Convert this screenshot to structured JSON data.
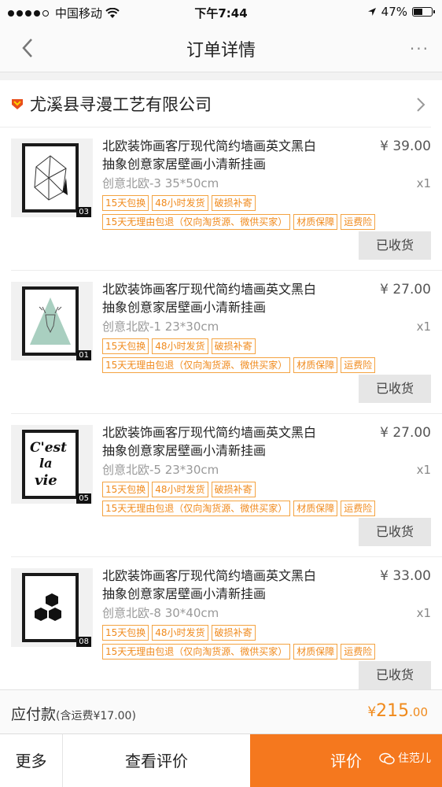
{
  "status": {
    "carrier": "中国移动",
    "time": "下午7:44",
    "battery": "47%"
  },
  "nav": {
    "title": "订单详情",
    "more": "···"
  },
  "shop": {
    "name": "尤溪县寻漫工艺有限公司"
  },
  "tags_row1": [
    "15天包换",
    "48小时发货",
    "破损补寄"
  ],
  "tags_row2": [
    "15天无理由包退（仅向淘货源、微供买家）",
    "材质保障",
    "运费险"
  ],
  "items": [
    {
      "title_line1": "北欧装饰画客厅现代简约墙画英文黑白",
      "title_line2": "抽象创意家居壁画小清新挂画",
      "sku": "创意北欧-3 35*50cm",
      "price": "¥ 39.00",
      "qty": "x1",
      "thumb_num": "03",
      "button": "已收货"
    },
    {
      "title_line1": "北欧装饰画客厅现代简约墙画英文黑白",
      "title_line2": "抽象创意家居壁画小清新挂画",
      "sku": "创意北欧-1 23*30cm",
      "price": "¥ 27.00",
      "qty": "x1",
      "thumb_num": "01",
      "button": "已收货"
    },
    {
      "title_line1": "北欧装饰画客厅现代简约墙画英文黑白",
      "title_line2": "抽象创意家居壁画小清新挂画",
      "sku": "创意北欧-5 23*30cm",
      "price": "¥ 27.00",
      "qty": "x1",
      "thumb_num": "05",
      "button": "已收货",
      "art_text": [
        "C'est",
        "la",
        "vie"
      ]
    },
    {
      "title_line1": "北欧装饰画客厅现代简约墙画英文黑白",
      "title_line2": "抽象创意家居壁画小清新挂画",
      "sku": "创意北欧-8 30*40cm",
      "price": "¥ 33.00",
      "qty": "x1",
      "thumb_num": "08",
      "button": "已收货"
    }
  ],
  "total": {
    "label": "应付款",
    "shipping": "(含运费¥17.00)",
    "currency": "¥",
    "amount_int": "215",
    "amount_dec": ".00"
  },
  "bottom": {
    "more": "更多",
    "view_review": "查看评价",
    "review": "评价",
    "watermark": "住范儿"
  },
  "colors": {
    "accent": "#f5781e",
    "tag": "#f08a1c"
  }
}
